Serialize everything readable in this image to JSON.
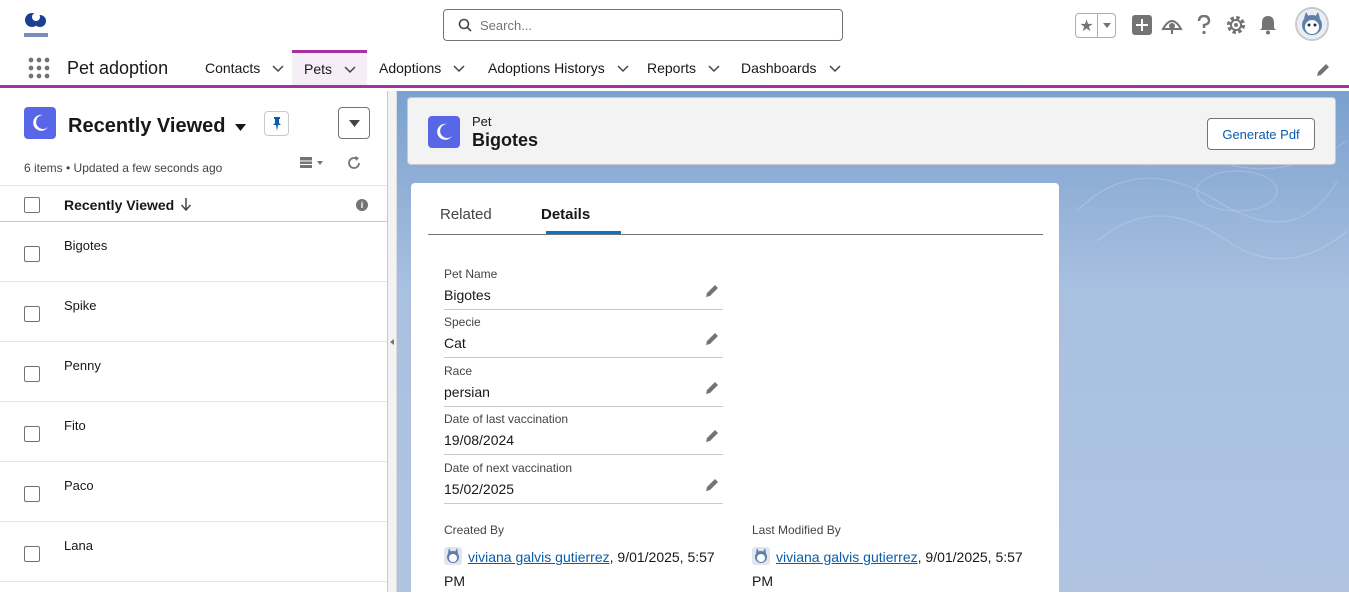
{
  "header": {
    "logo_text": "Pet adoption",
    "search_placeholder": "Search..."
  },
  "nav": {
    "app_name": "Pet adoption",
    "tabs": [
      {
        "label": "Contacts",
        "active": false
      },
      {
        "label": "Pets",
        "active": true
      },
      {
        "label": "Adoptions",
        "active": false
      },
      {
        "label": "Adoptions Historys",
        "active": false
      },
      {
        "label": "Reports",
        "active": false
      },
      {
        "label": "Dashboards",
        "active": false
      }
    ]
  },
  "list_view": {
    "title": "Recently Viewed",
    "subtitle": "6 items • Updated a few seconds ago",
    "column_header": "Recently Viewed",
    "items": [
      "Bigotes",
      "Spike",
      "Penny",
      "Fito",
      "Paco",
      "Lana"
    ]
  },
  "record": {
    "object_label": "Pet",
    "name": "Bigotes",
    "action_button": "Generate Pdf",
    "tabs": [
      "Related",
      "Details"
    ],
    "active_tab": "Details",
    "fields": [
      {
        "label": "Pet Name",
        "value": "Bigotes"
      },
      {
        "label": "Specie",
        "value": "Cat"
      },
      {
        "label": "Race",
        "value": "persian"
      },
      {
        "label": "Date of last vaccination",
        "value": "19/08/2024"
      },
      {
        "label": "Date of next vaccination",
        "value": "15/02/2025"
      }
    ],
    "created_by": {
      "label": "Created By",
      "user": "viviana galvis gutierrez",
      "date": ", 9/01/2025, 5:57 PM"
    },
    "last_modified_by": {
      "label": "Last Modified By",
      "user": "viviana galvis gutierrez",
      "date": ", 9/01/2025, 5:57 PM"
    }
  },
  "colors": {
    "accent": "#a3319f",
    "brand_blue": "#0176d3",
    "object_icon": "#5867e8",
    "link": "#0b5cab"
  },
  "icons": [
    "search-icon",
    "star-icon",
    "add-icon",
    "trailhead-icon",
    "help-icon",
    "setup-gear-icon",
    "notification-bell-icon",
    "waffle-icon",
    "pencil-icon",
    "moon-icon",
    "pin-icon",
    "refresh-icon",
    "info-icon",
    "user-icon"
  ]
}
